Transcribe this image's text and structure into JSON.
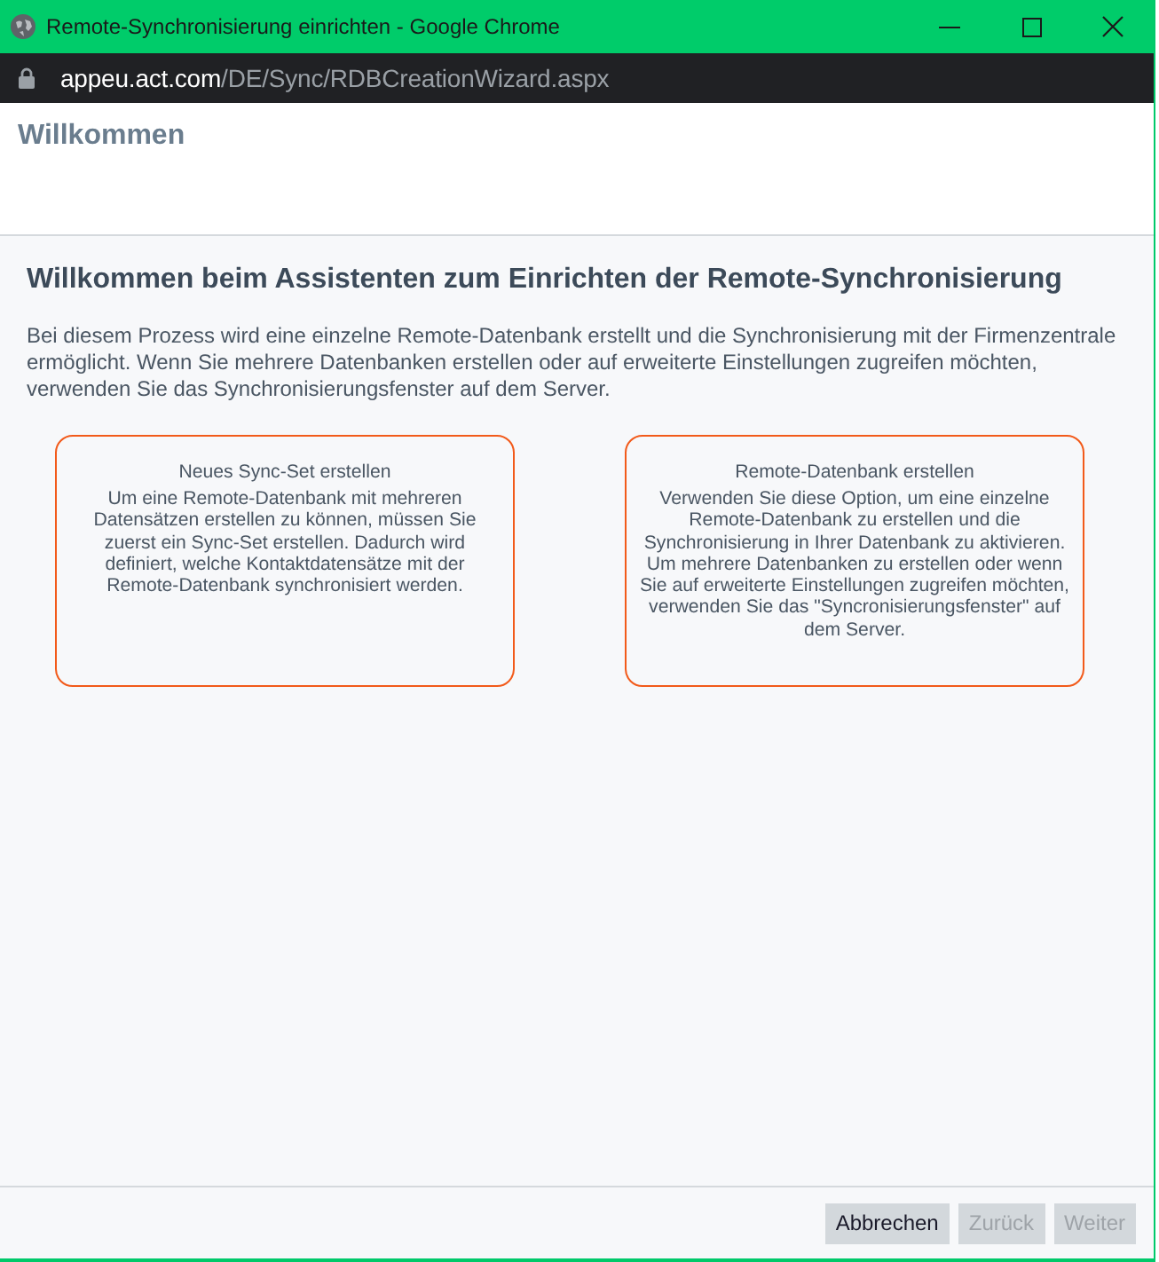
{
  "window": {
    "title": "Remote-Synchronisierung einrichten - Google Chrome"
  },
  "address_bar": {
    "host": "appeu.act.com",
    "path": "/DE/Sync/RDBCreationWizard.aspx"
  },
  "page_header": {
    "title": "Willkommen"
  },
  "content": {
    "heading": "Willkommen beim Assistenten zum Einrichten der Remote-Synchronisierung",
    "intro": "Bei diesem Prozess wird eine einzelne Remote-Datenbank erstellt und die Synchronisierung mit der Firmenzentrale ermöglicht. Wenn Sie mehrere Datenbanken erstellen oder auf erweiterte Einstellungen zugreifen möchten, verwenden Sie das Synchronisierungsfenster auf dem Server."
  },
  "options": [
    {
      "title": "Neues Sync-Set erstellen",
      "description": "Um eine Remote-Datenbank mit mehreren Datensätzen erstellen zu können, müssen Sie zuerst ein Sync-Set erstellen. Dadurch wird definiert, welche Kontaktdatensätze mit der Remote-Datenbank synchronisiert werden."
    },
    {
      "title": "Remote-Datenbank erstellen",
      "description": "Verwenden Sie diese Option, um eine einzelne Remote-Datenbank zu erstellen und die Synchronisierung in Ihrer Datenbank zu aktivieren. Um mehrere Datenbanken zu erstellen oder wenn Sie auf erweiterte Einstellungen zugreifen möchten, verwenden Sie das \"Syncronisierungsfenster\" auf dem Server."
    }
  ],
  "buttons": [
    {
      "label": "Abbrechen",
      "disabled": false
    },
    {
      "label": "Zurück",
      "disabled": true
    },
    {
      "label": "Weiter",
      "disabled": true
    }
  ]
}
